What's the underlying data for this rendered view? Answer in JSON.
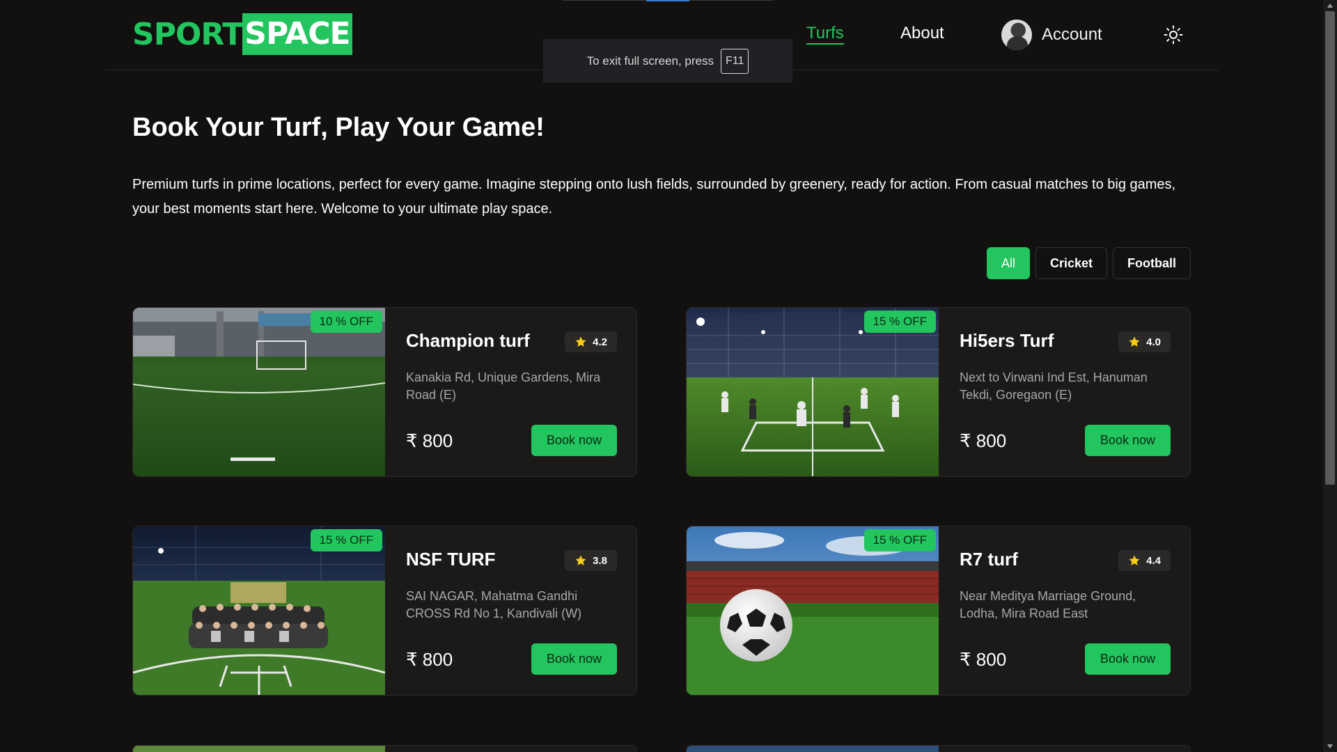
{
  "header": {
    "logo_part1": "SPORT",
    "logo_part2": "SPACE",
    "nav": {
      "turfs": "Turfs",
      "about": "About",
      "account": "Account"
    }
  },
  "fullscreen_tip": {
    "text": "To exit full screen, press",
    "key": "F11"
  },
  "hero": {
    "title": "Book Your Turf, Play Your Game!",
    "description": "Premium turfs in prime locations, perfect for every game. Imagine stepping onto lush fields, surrounded by greenery, ready for action. From casual matches to big games, your best moments start here. Welcome to your ultimate play space."
  },
  "filters": {
    "all": "All",
    "cricket": "Cricket",
    "football": "Football",
    "active": "All"
  },
  "turfs": [
    {
      "name": "Champion turf",
      "rating": "4.2",
      "discount": "10 % OFF",
      "address": "Kanakia Rd, Unique Gardens, Mira Road (E)",
      "price": "800",
      "book": "Book now",
      "image": "football-goal-turf"
    },
    {
      "name": "Hi5ers Turf",
      "rating": "4.0",
      "discount": "15 % OFF",
      "address": "Next to Virwani Ind Est, Hanuman Tekdi, Goregaon (E)",
      "price": "800",
      "book": "Book now",
      "image": "box-cricket-players"
    },
    {
      "name": "NSF TURF",
      "rating": "3.8",
      "discount": "15 % OFF",
      "address": "SAI NAGAR, Mahatma Gandhi CROSS Rd No 1, Kandivali (W)",
      "price": "800",
      "book": "Book now",
      "image": "cricket-team-photo"
    },
    {
      "name": "R7 turf",
      "rating": "4.4",
      "discount": "15 % OFF",
      "address": "Near Meditya Marriage Ground, Lodha, Mira Road East",
      "price": "800",
      "book": "Book now",
      "image": "football-stadium"
    }
  ],
  "currency_symbol": "₹",
  "colors": {
    "accent": "#22c55e",
    "background": "#121110",
    "card": "#1c1a19",
    "muted_text": "#a8a8a8",
    "star": "#facc15"
  },
  "icons": {
    "theme_toggle": "sun-icon",
    "rating": "star-icon",
    "avatar": "user-avatar"
  }
}
